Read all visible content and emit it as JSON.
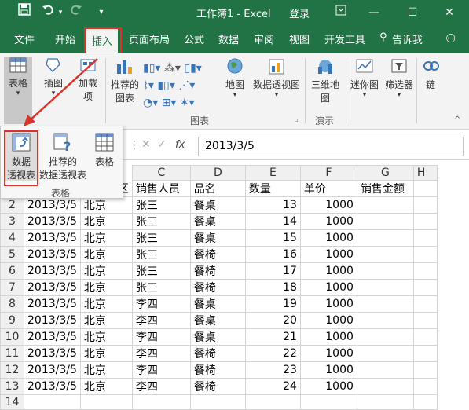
{
  "titlebar": {
    "title": "工作簿1 - Excel",
    "login": "登录",
    "save_icon": "save-icon",
    "undo_icon": "undo-icon",
    "redo_icon": "redo-icon"
  },
  "tabs": [
    "文件",
    "开始",
    "插入",
    "页面布局",
    "公式",
    "数据",
    "审阅",
    "视图",
    "开发工具",
    "告诉我"
  ],
  "ribbon": {
    "table_btn": "表格",
    "illustrations_btn": "插图",
    "addins_btn1": "加载",
    "addins_btn2": "项",
    "rec_charts_btn1": "推荐的",
    "rec_charts_btn2": "图表",
    "map_btn": "地图",
    "pivot_chart_btn": "数据透视图",
    "3d_btn1": "三维地",
    "3d_btn2": "图",
    "sparkline_btn": "迷你图",
    "filter_btn": "筛选器",
    "link_btn": "链",
    "chart_group": "图表",
    "demo_group": "演示"
  },
  "popup": {
    "pivot_label1": "数据",
    "pivot_label2": "透视表",
    "rec_pivot1": "推荐的",
    "rec_pivot2": "数据透视表",
    "table_label": "表格",
    "group_label": "表格"
  },
  "formula": {
    "value": "2013/3/5",
    "fx": "fx"
  },
  "columns": [
    "C",
    "D",
    "E",
    "F",
    "G",
    "H"
  ],
  "headers_row1": {
    "b": "区",
    "c": "销售人员",
    "d": "品名",
    "e": "数量",
    "f": "单价",
    "g": "销售金额"
  },
  "rows": [
    {
      "n": "2",
      "a": "2013/3/5",
      "b": "北京",
      "c": "张三",
      "d": "餐桌",
      "e": "13",
      "f": "1000"
    },
    {
      "n": "3",
      "a": "2013/3/5",
      "b": "北京",
      "c": "张三",
      "d": "餐桌",
      "e": "14",
      "f": "1000"
    },
    {
      "n": "4",
      "a": "2013/3/5",
      "b": "北京",
      "c": "张三",
      "d": "餐桌",
      "e": "15",
      "f": "1000"
    },
    {
      "n": "5",
      "a": "2013/3/5",
      "b": "北京",
      "c": "张三",
      "d": "餐椅",
      "e": "16",
      "f": "1000"
    },
    {
      "n": "6",
      "a": "2013/3/5",
      "b": "北京",
      "c": "张三",
      "d": "餐椅",
      "e": "17",
      "f": "1000"
    },
    {
      "n": "7",
      "a": "2013/3/5",
      "b": "北京",
      "c": "张三",
      "d": "餐椅",
      "e": "18",
      "f": "1000"
    },
    {
      "n": "8",
      "a": "2013/3/5",
      "b": "北京",
      "c": "李四",
      "d": "餐桌",
      "e": "19",
      "f": "1000"
    },
    {
      "n": "9",
      "a": "2013/3/5",
      "b": "北京",
      "c": "李四",
      "d": "餐桌",
      "e": "20",
      "f": "1000"
    },
    {
      "n": "10",
      "a": "2013/3/5",
      "b": "北京",
      "c": "李四",
      "d": "餐桌",
      "e": "21",
      "f": "1000"
    },
    {
      "n": "11",
      "a": "2013/3/5",
      "b": "北京",
      "c": "李四",
      "d": "餐椅",
      "e": "22",
      "f": "1000"
    },
    {
      "n": "12",
      "a": "2013/3/5",
      "b": "北京",
      "c": "李四",
      "d": "餐椅",
      "e": "23",
      "f": "1000"
    },
    {
      "n": "13",
      "a": "2013/3/5",
      "b": "北京",
      "c": "李四",
      "d": "餐椅",
      "e": "24",
      "f": "1000"
    },
    {
      "n": "14",
      "a": "",
      "b": "",
      "c": "",
      "d": "",
      "e": "",
      "f": ""
    }
  ],
  "colors": {
    "brand": "#217346",
    "highlight": "#d9342b"
  }
}
